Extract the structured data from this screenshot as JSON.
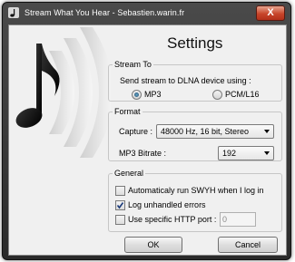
{
  "window": {
    "title": "Stream What You Hear - Sebastien.warin.fr",
    "close_symbol": "X"
  },
  "header": {
    "title": "Settings"
  },
  "stream_to": {
    "legend": "Stream To",
    "description": "Send stream to DLNA device using :",
    "options": [
      {
        "label": "MP3",
        "selected": true
      },
      {
        "label": "PCM/L16",
        "selected": false
      }
    ]
  },
  "format": {
    "legend": "Format",
    "capture_label": "Capture :",
    "capture_value": "48000 Hz, 16 bit, Stereo",
    "bitrate_label": "MP3 Bitrate :",
    "bitrate_value": "192"
  },
  "general": {
    "legend": "General",
    "options": [
      {
        "label": "Automaticaly run SWYH when I log in",
        "checked": false
      },
      {
        "label": "Log unhandled errors",
        "checked": true
      },
      {
        "label": "Use specific HTTP port :",
        "checked": false
      }
    ],
    "port_value": "0"
  },
  "buttons": {
    "ok": "OK",
    "cancel": "Cancel"
  },
  "icons": {
    "app": "music-note-icon",
    "logo": "music-note-sound-waves-icon",
    "close": "close-icon",
    "check": "checkmark-icon"
  }
}
